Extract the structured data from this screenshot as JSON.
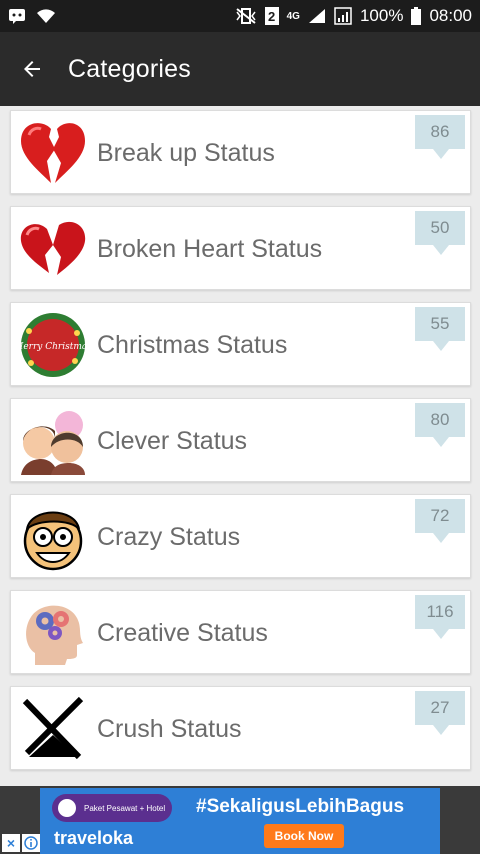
{
  "status_bar": {
    "sim_number": "2",
    "network": "4G",
    "battery": "100%",
    "time": "08:00"
  },
  "app_bar": {
    "title": "Categories"
  },
  "categories": [
    {
      "label": "Break up Status",
      "count": "86",
      "icon": "broken-heart-split-icon"
    },
    {
      "label": "Broken Heart Status",
      "count": "50",
      "icon": "broken-heart-icon"
    },
    {
      "label": "Christmas Status",
      "count": "55",
      "icon": "christmas-wreath-icon"
    },
    {
      "label": "Clever Status",
      "count": "80",
      "icon": "couple-icon"
    },
    {
      "label": "Crazy Status",
      "count": "72",
      "icon": "crazy-face-icon"
    },
    {
      "label": "Creative Status",
      "count": "116",
      "icon": "creative-head-icon"
    },
    {
      "label": "Crush Status",
      "count": "27",
      "icon": "crush-icon"
    }
  ],
  "ad": {
    "pill_text": "Paket Pesawat + Hotel",
    "hashtag": "#SekaligusLebihBagus",
    "brand": "traveloka",
    "cta": "Book Now",
    "colors": {
      "background": "#2e7fd6",
      "pill": "#5b2f8f",
      "cta": "#ff7a1a"
    }
  },
  "colors": {
    "status_bar": "#1c1c1c",
    "app_bar": "#2b2b2b",
    "background": "#ececec",
    "badge": "#cfe2e8",
    "label_text": "#6b6b6b"
  },
  "christmas_icon_text": "Merry Christmas"
}
